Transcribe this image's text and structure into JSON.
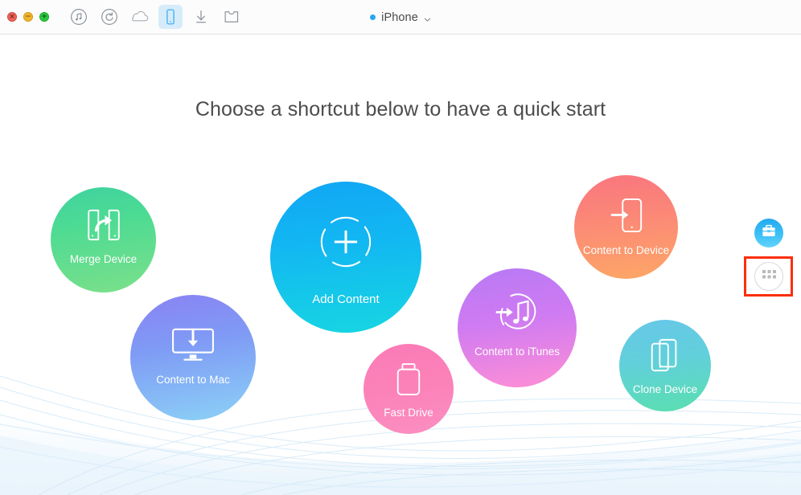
{
  "window": {
    "traffic_lights": [
      {
        "name": "close",
        "glyph": "×",
        "color": "#ec6559"
      },
      {
        "name": "minimize",
        "glyph": "−",
        "color": "#f0b52c"
      },
      {
        "name": "zoom",
        "glyph": "+",
        "color": "#2dc93f"
      }
    ]
  },
  "toolbar": {
    "items": [
      {
        "icon": "music-note-circle-icon",
        "label": "Music",
        "active": false
      },
      {
        "icon": "restore-circle-icon",
        "label": "Restore",
        "active": false
      },
      {
        "icon": "cloud-icon",
        "label": "Cloud",
        "active": false
      },
      {
        "icon": "iphone-icon",
        "label": "Device",
        "active": true
      },
      {
        "icon": "download-arrow-icon",
        "label": "Downloader",
        "active": false
      },
      {
        "icon": "toolkit-icon",
        "label": "Toolkit",
        "active": false
      }
    ]
  },
  "device": {
    "status_dot_color": "#2aa6f0",
    "name": "iPhone",
    "chevron": "chevron-down-icon"
  },
  "main": {
    "headline": "Choose a shortcut below to have a quick start",
    "shortcuts": [
      {
        "id": "merge",
        "label": "Merge Device",
        "icon": "two-phones-arrow-icon",
        "color_start": "#3fd2a0",
        "color_end": "#7ce08a"
      },
      {
        "id": "add",
        "label": "Add Content",
        "icon": "plus-in-dashed-circle-icon",
        "color_start": "#11a6f5",
        "color_end": "#17d6e2"
      },
      {
        "id": "ctdev",
        "label": "Content to Device",
        "icon": "phone-arrow-in-icon",
        "color_start": "#f9757f",
        "color_end": "#fda766"
      },
      {
        "id": "ctmac",
        "label": "Content to Mac",
        "icon": "monitor-download-icon",
        "color_start": "#8a82f3",
        "color_end": "#8cd2f6"
      },
      {
        "id": "ctit",
        "label": "Content to iTunes",
        "icon": "music-note-arrow-icon",
        "color_start": "#b879f4",
        "color_end": "#ff8fd4"
      },
      {
        "id": "fast",
        "label": "Fast Drive",
        "icon": "usb-drive-icon",
        "color_start": "#fb7bb6",
        "color_end": "#fb8fc2"
      },
      {
        "id": "clone",
        "label": "Clone Device",
        "icon": "two-phones-stacked-icon",
        "color_start": "#68c7ea",
        "color_end": "#5adfae"
      }
    ]
  },
  "rail": {
    "toolbox_button": {
      "icon": "toolbox-icon",
      "label": "Toolbox",
      "color": "#22a9f0"
    },
    "grid_button": {
      "icon": "grid-dots-icon",
      "label": "More Shortcuts",
      "highlighted": true,
      "highlight_color": "#fb2e0a"
    }
  }
}
